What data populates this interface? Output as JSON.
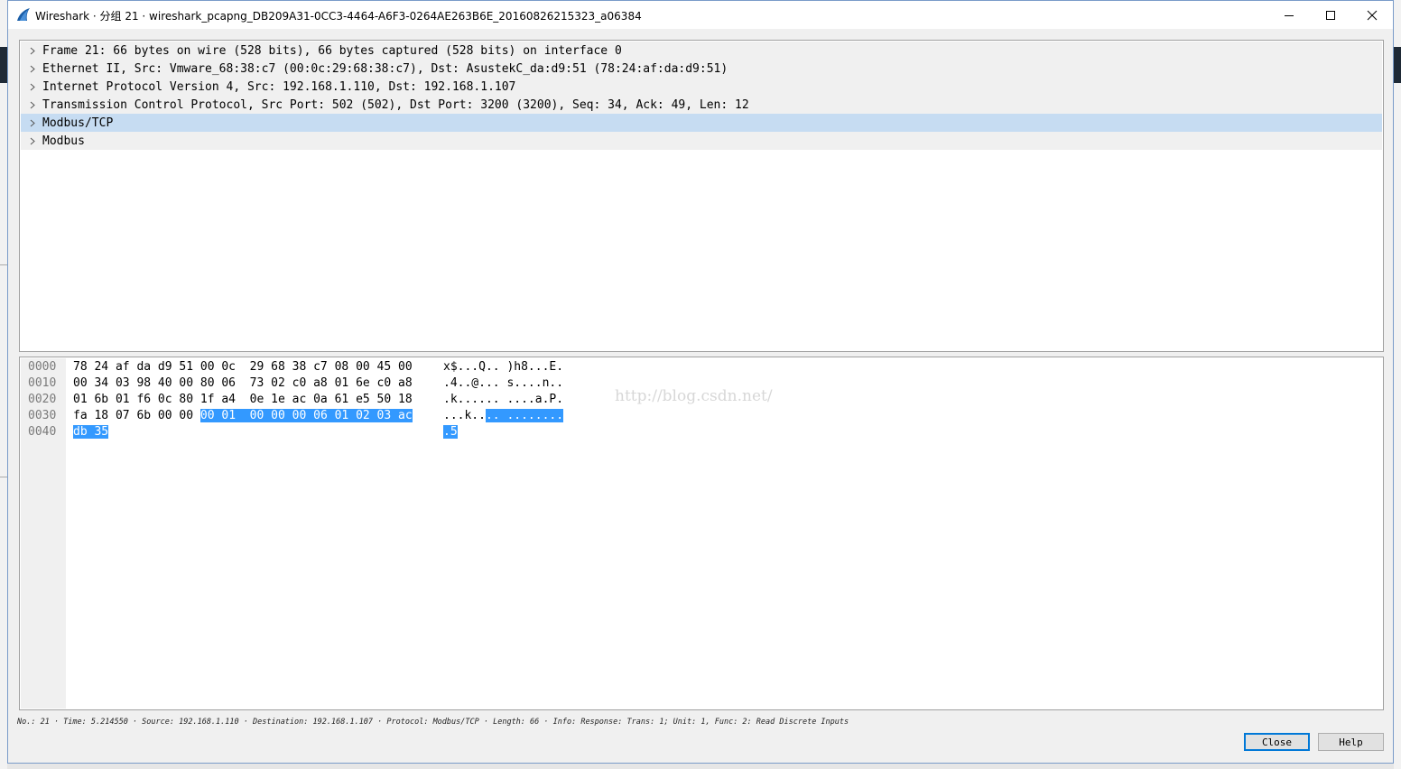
{
  "window": {
    "title": "Wireshark · 分组 21 · wireshark_pcapng_DB209A31-0CC3-4464-A6F3-0264AE263B6E_20160826215323_a06384",
    "icon": "wireshark-fin-icon",
    "controls": {
      "minimize": "minimize-icon",
      "maximize": "maximize-icon",
      "close": "close-icon"
    }
  },
  "tree": {
    "items": [
      {
        "label": "Frame 21: 66 bytes on wire (528 bits), 66 bytes captured (528 bits) on interface 0",
        "selected": false
      },
      {
        "label": "Ethernet II, Src: Vmware_68:38:c7 (00:0c:29:68:38:c7), Dst: AsustekC_da:d9:51 (78:24:af:da:d9:51)",
        "selected": false
      },
      {
        "label": "Internet Protocol Version 4, Src: 192.168.1.110, Dst: 192.168.1.107",
        "selected": false
      },
      {
        "label": "Transmission Control Protocol, Src Port: 502 (502), Dst Port: 3200 (3200), Seq: 34, Ack: 49, Len: 12",
        "selected": true
      },
      {
        "label": "Modbus/TCP",
        "selected": true
      },
      {
        "label": "Modbus",
        "selected": false
      }
    ]
  },
  "bytes": {
    "rows": [
      {
        "offset": "0000",
        "hex": "78 24 af da d9 51 00 0c  29 68 38 c7 08 00 45 00",
        "ascii": "x$...Q.. )h8...E."
      },
      {
        "offset": "0010",
        "hex": "00 34 03 98 40 00 80 06  73 02 c0 a8 01 6e c0 a8",
        "ascii": ".4..@... s....n.."
      },
      {
        "offset": "0020",
        "hex": "01 6b 01 f6 0c 80 1f a4  0e 1e ac 0a 61 e5 50 18",
        "ascii": ".k...... ....a.P."
      },
      {
        "offset": "0030",
        "hex_plain": "fa 18 07 6b 00 00 ",
        "hex_hl": "00 01  00 00 00 06 01 02 03 ac",
        "ascii_plain": "...k..",
        "ascii_hl": ".. ........"
      },
      {
        "offset": "0040",
        "hex_hl": "db 35",
        "ascii_hl": ".5"
      }
    ],
    "watermark": "http://blog.csdn.net/"
  },
  "status": "No.: 21 · Time: 5.214550 · Source: 192.168.1.110 · Destination: 192.168.1.107 · Protocol: Modbus/TCP · Length: 66 · Info: Response: Trans: 1; Unit: 1, Func: 2: Read Discrete Inputs",
  "buttons": {
    "close": "Close",
    "help": "Help"
  },
  "colors": {
    "selection": "#c6dcf2",
    "byte_highlight": "#3399ff",
    "accent": "#0078d7"
  }
}
